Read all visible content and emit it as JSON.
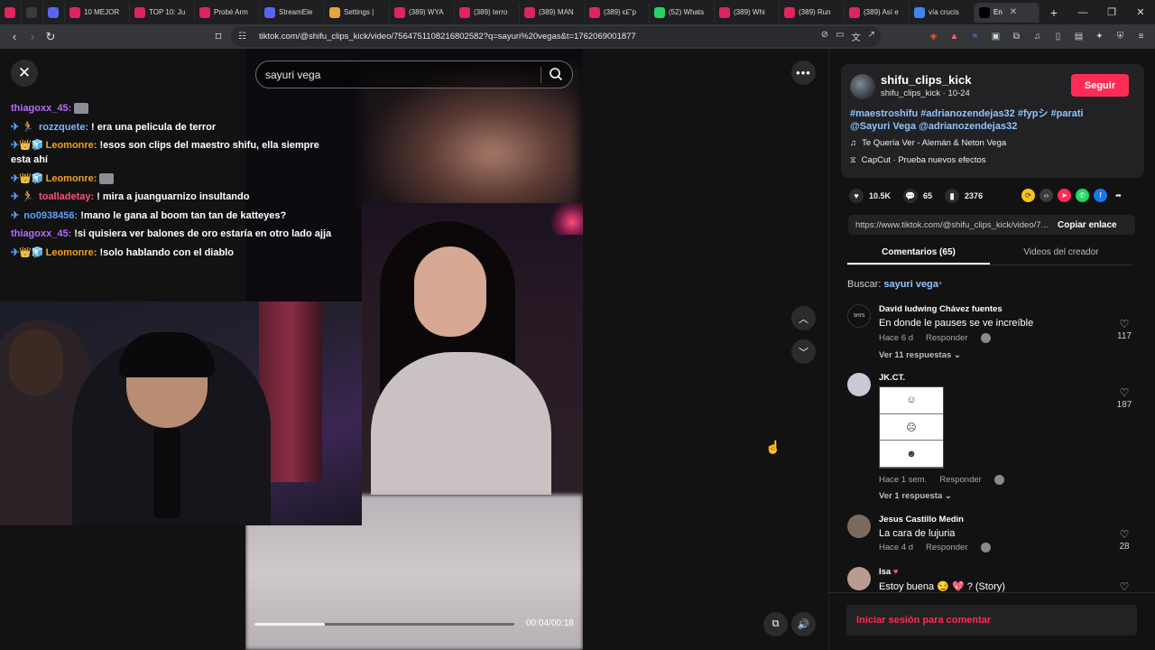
{
  "browser": {
    "tabs": [
      {
        "title": "",
        "color": "#e0245e"
      },
      {
        "title": "",
        "color": "#3b3b3b"
      },
      {
        "title": "",
        "color": "#5865f2"
      },
      {
        "title": "10 MEJOR",
        "color": "#e0245e"
      },
      {
        "title": "TOP 10: Ju",
        "color": "#e0245e"
      },
      {
        "title": "Probé Arm",
        "color": "#e0245e"
      },
      {
        "title": "StreamEle",
        "color": "#5865f2"
      },
      {
        "title": "Settings |",
        "color": "#e8a33a"
      },
      {
        "title": "(389) WYA",
        "color": "#e0245e"
      },
      {
        "title": "(389) terro",
        "color": "#e0245e"
      },
      {
        "title": "(389) MAN",
        "color": "#e0245e"
      },
      {
        "title": "(389) ϵ£”p",
        "color": "#e0245e"
      },
      {
        "title": "(52) Whats",
        "color": "#25d366"
      },
      {
        "title": "(389) Whi",
        "color": "#e0245e"
      },
      {
        "title": "(389) Run",
        "color": "#e0245e"
      },
      {
        "title": "(389) Así e",
        "color": "#e0245e"
      },
      {
        "title": "vía crucis",
        "color": "#4285f4"
      },
      {
        "title": "En",
        "color": "#000000"
      }
    ],
    "url": "tiktok.com/@shifu_clips_kick/video/7564751108216802582?q=sayuri%20vegas&t=1762069001877"
  },
  "player": {
    "search_query": "sayuri vega",
    "current_time": "00:04",
    "duration": "00:18",
    "progress": 0.27,
    "time_separator": "/"
  },
  "chat": [
    {
      "badges": "",
      "user": "thiagoxx_45:",
      "user_color": "#b36cff",
      "text": ""
    },
    {
      "badges": "✈ 🏃 ",
      "user": "rozzquete:",
      "user_color": "#7fb4ff",
      "text": "! era una pelicula de terror"
    },
    {
      "badges": "✈👑🧊",
      "user": "Leomonre:",
      "user_color": "#f0a020",
      "text": "!esos son clips del maestro shifu, ella siempre esta ahí"
    },
    {
      "badges": "✈👑🧊",
      "user": "Leomonre:",
      "user_color": "#f0a020",
      "text": ""
    },
    {
      "badges": "✈ 🏃 ",
      "user": "toalladetay:",
      "user_color": "#ff4f7b",
      "text": "! mira a juanguarnizo insultando"
    },
    {
      "badges": "✈ ",
      "user": "no0938456:",
      "user_color": "#5aa2ff",
      "text": "!mano le gana al boom tan tan de katteyes?"
    },
    {
      "badges": "",
      "user": "thiagoxx_45:",
      "user_color": "#b36cff",
      "text": "!si quisiera ver balones de oro estaría en otro lado ajja"
    },
    {
      "badges": "✈👑🧊",
      "user": "Leomonre:",
      "user_color": "#f0a020",
      "text": "!solo hablando con el diablo"
    }
  ],
  "post": {
    "author": "shifu_clips_kick",
    "author_sub": "shifu_clips_kick · 10-24",
    "follow_label": "Seguir",
    "description": "#maestroshifu #adrianozendejas32 #fypシ #parati @Sayuri Vega @adrianozendejas32",
    "music": "Te Quería Ver - Alemán & Neton Vega",
    "effect": "CapCut · Prueba nuevos efectos",
    "likes": "10.5K",
    "comments": "65",
    "saves": "2376",
    "link": "https://www.tiktok.com/@shifu_clips_kick/video/7...",
    "copy_label": "Copiar enlace"
  },
  "panel_tabs": {
    "comments": "Comentarios (65)",
    "creator": "Videos del creador"
  },
  "search_note": {
    "label": "Buscar:",
    "term": "sayuri vega"
  },
  "comments": [
    {
      "user": "David ludwing Chávez fuentes",
      "avatar_text": "SHI'S",
      "text": "En donde le pauses se ve increíble",
      "time": "Hace 6 d",
      "reply": "Responder",
      "replies": "Ver 11 respuestas",
      "likes": "117"
    },
    {
      "user": "JK.CT.",
      "avatar_text": "",
      "text": "",
      "time": "Hace 1 sem.",
      "reply": "Responder",
      "replies": "Ver 1 respuesta",
      "likes": "187"
    },
    {
      "user": "Jesus Castillo Medin",
      "avatar_text": "",
      "text": "La cara de lujuria",
      "time": "Hace 4 d",
      "reply": "Responder",
      "replies": "",
      "likes": "28"
    },
    {
      "user": "Isa",
      "avatar_text": "",
      "text": "Estoy buena 😏 💖 ? (Story)",
      "time": "",
      "reply": "",
      "replies": "",
      "likes": ""
    }
  ],
  "login_label": "Iniciar sesión para comentar"
}
